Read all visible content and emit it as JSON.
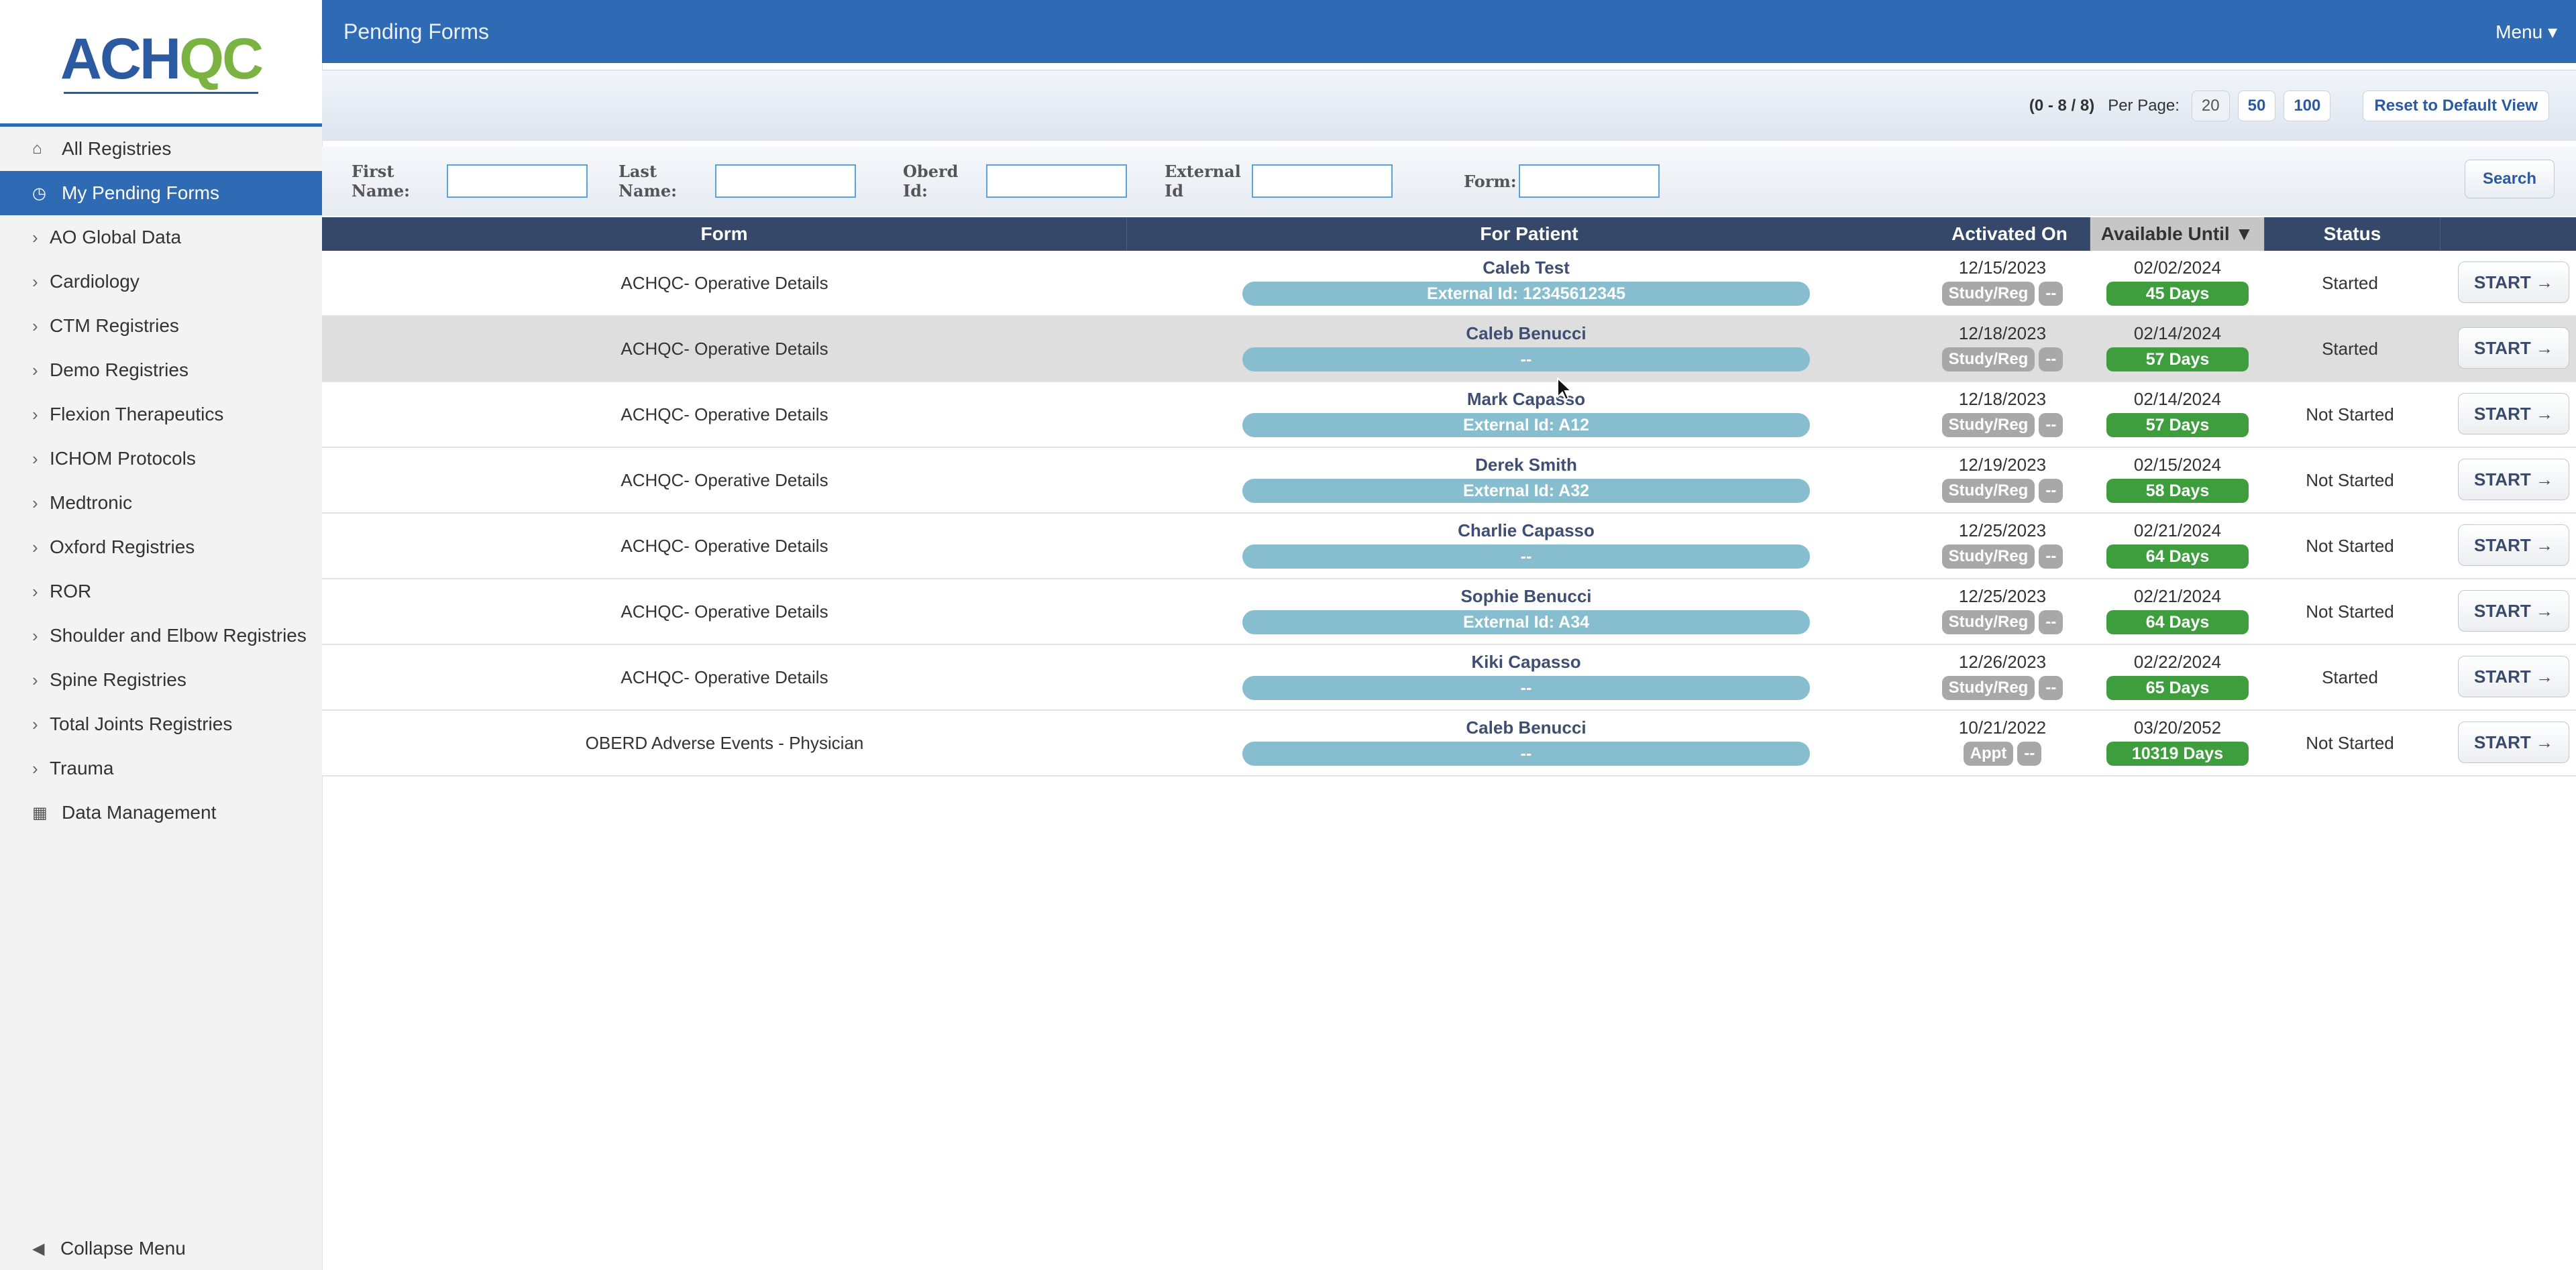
{
  "sidebar": {
    "logo": "ACHQC",
    "items": [
      {
        "label": "All Registries",
        "icon": "home-icon"
      },
      {
        "label": "My Pending Forms",
        "icon": "clock-icon",
        "active": true
      },
      {
        "label": "AO Global Data",
        "icon": "chevron-right-icon"
      },
      {
        "label": "Cardiology",
        "icon": "chevron-right-icon"
      },
      {
        "label": "CTM Registries",
        "icon": "chevron-right-icon"
      },
      {
        "label": "Demo Registries",
        "icon": "chevron-right-icon"
      },
      {
        "label": "Flexion Therapeutics",
        "icon": "chevron-right-icon"
      },
      {
        "label": "ICHOM Protocols",
        "icon": "chevron-right-icon"
      },
      {
        "label": "Medtronic",
        "icon": "chevron-right-icon"
      },
      {
        "label": "Oxford Registries",
        "icon": "chevron-right-icon"
      },
      {
        "label": "ROR",
        "icon": "chevron-right-icon"
      },
      {
        "label": "Shoulder and Elbow Registries",
        "icon": "chevron-right-icon"
      },
      {
        "label": "Spine Registries",
        "icon": "chevron-right-icon"
      },
      {
        "label": "Total Joints Registries",
        "icon": "chevron-right-icon"
      },
      {
        "label": "Trauma",
        "icon": "chevron-right-icon"
      },
      {
        "label": "Data Management",
        "icon": "table-icon"
      }
    ],
    "collapse_label": "Collapse Menu"
  },
  "header": {
    "title": "Pending Forms",
    "menu_label": "Menu ▾"
  },
  "pager": {
    "count": "(0 - 8 / 8)",
    "per_page_label": "Per Page:",
    "options": [
      "20",
      "50",
      "100"
    ],
    "current": "20",
    "reset_label": "Reset to Default View"
  },
  "filters": {
    "first_name": "First Name:",
    "last_name": "Last Name:",
    "oberd_id": "Oberd Id:",
    "external_id": "External Id",
    "form": "Form:",
    "search_label": "Search"
  },
  "table": {
    "headers": {
      "form": "Form",
      "patient": "For Patient",
      "activated": "Activated On",
      "available": "Available Until ▼",
      "status": "Status"
    },
    "start_label": "START →",
    "rows": [
      {
        "form": "ACHQC- Operative Details",
        "patient": "Caleb Test",
        "ext": "External Id: 12345612345",
        "activated": "12/15/2023",
        "tag1": "Study/Reg",
        "tag2": "--",
        "until": "02/02/2024",
        "days": "45 Days",
        "status": "Started"
      },
      {
        "form": "ACHQC- Operative Details",
        "patient": "Caleb Benucci",
        "ext": "--",
        "activated": "12/18/2023",
        "tag1": "Study/Reg",
        "tag2": "--",
        "until": "02/14/2024",
        "days": "57 Days",
        "status": "Started"
      },
      {
        "form": "ACHQC- Operative Details",
        "patient": "Mark Capasso",
        "ext": "External Id: A12",
        "activated": "12/18/2023",
        "tag1": "Study/Reg",
        "tag2": "--",
        "until": "02/14/2024",
        "days": "57 Days",
        "status": "Not Started"
      },
      {
        "form": "ACHQC- Operative Details",
        "patient": "Derek Smith",
        "ext": "External Id: A32",
        "activated": "12/19/2023",
        "tag1": "Study/Reg",
        "tag2": "--",
        "until": "02/15/2024",
        "days": "58 Days",
        "status": "Not Started"
      },
      {
        "form": "ACHQC- Operative Details",
        "patient": "Charlie Capasso",
        "ext": "--",
        "activated": "12/25/2023",
        "tag1": "Study/Reg",
        "tag2": "--",
        "until": "02/21/2024",
        "days": "64 Days",
        "status": "Not Started"
      },
      {
        "form": "ACHQC- Operative Details",
        "patient": "Sophie Benucci",
        "ext": "External Id: A34",
        "activated": "12/25/2023",
        "tag1": "Study/Reg",
        "tag2": "--",
        "until": "02/21/2024",
        "days": "64 Days",
        "status": "Not Started"
      },
      {
        "form": "ACHQC- Operative Details",
        "patient": "Kiki Capasso",
        "ext": "--",
        "activated": "12/26/2023",
        "tag1": "Study/Reg",
        "tag2": "--",
        "until": "02/22/2024",
        "days": "65 Days",
        "status": "Started"
      },
      {
        "form": "OBERD Adverse Events - Physician",
        "patient": "Caleb Benucci",
        "ext": "--",
        "activated": "10/21/2022",
        "tag1": "Appt",
        "tag2": "--",
        "until": "03/20/2052",
        "days": "10319 Days",
        "status": "Not Started"
      }
    ]
  }
}
